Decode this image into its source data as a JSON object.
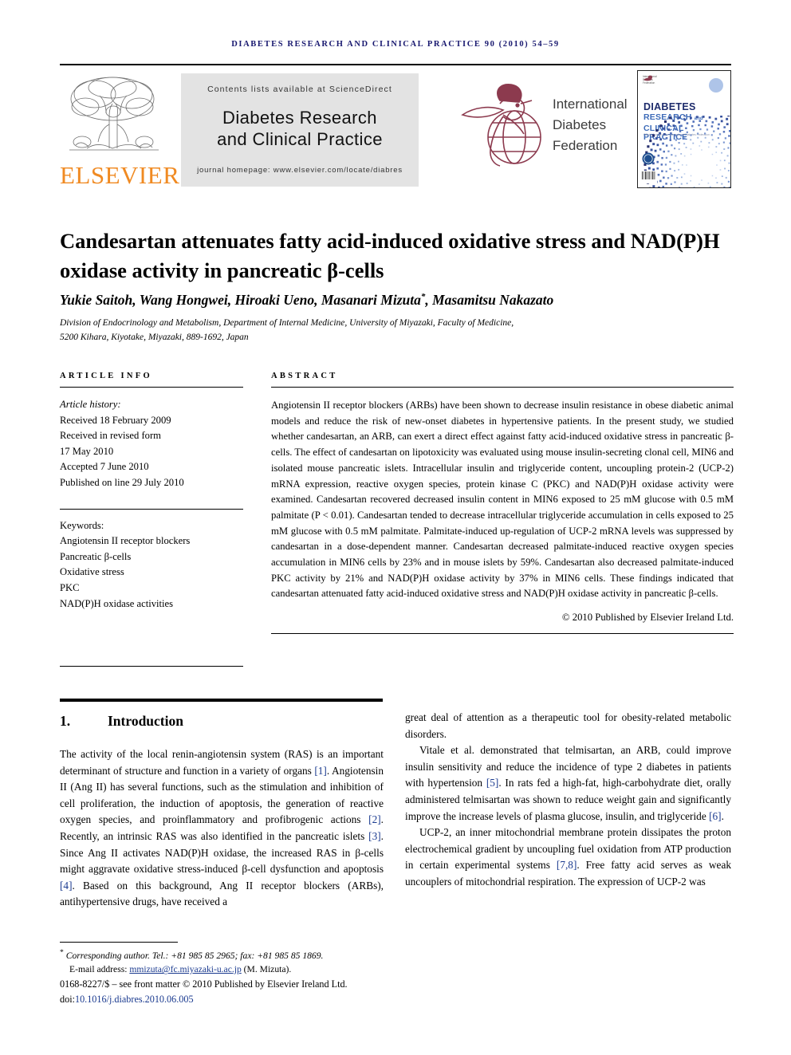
{
  "running_head": "Diabetes Research and Clinical Practice 90 (2010) 54–59",
  "masthead": {
    "publisher_name": "ELSEVIER",
    "sciencedirect_line": "Contents lists available at ScienceDirect",
    "journal_title_line1": "Diabetes Research",
    "journal_title_line2": "and Clinical Practice",
    "homepage_line": "journal homepage: www.elsevier.com/locate/diabres",
    "idf_line1": "International",
    "idf_line2": "Diabetes",
    "idf_line3": "Federation",
    "cover": {
      "idf_mini": "International\nDiabetes\nFederation",
      "title_top": "DIABETES",
      "title_rest": "RESEARCH and\nCLINICAL PRACTICE",
      "subtitle": "Official Journal of the International Diabetes Federation"
    }
  },
  "article": {
    "title": "Candesartan attenuates fatty acid-induced oxidative stress and NAD(P)H oxidase activity in pancreatic β-cells",
    "authors": "Yukie Saitoh, Wang Hongwei, Hiroaki Ueno, Masanari Mizuta",
    "author_marker": "*",
    "authors_tail": ", Masamitsu Nakazato",
    "affiliation_line1": "Division of Endocrinology and Metabolism, Department of Internal Medicine, University of Miyazaki, Faculty of Medicine,",
    "affiliation_line2": "5200 Kihara, Kiyotake, Miyazaki, 889-1692, Japan"
  },
  "info": {
    "heading": "Article info",
    "history_label": "Article history:",
    "received": "Received 18 February 2009",
    "revised_label": "Received in revised form",
    "revised_date": "17 May 2010",
    "accepted": "Accepted 7 June 2010",
    "published": "Published on line 29 July 2010",
    "keywords_label": "Keywords:",
    "keywords": [
      "Angiotensin II receptor blockers",
      "Pancreatic β-cells",
      "Oxidative stress",
      "PKC",
      "NAD(P)H oxidase activities"
    ]
  },
  "abstract": {
    "heading": "Abstract",
    "text": "Angiotensin II receptor blockers (ARBs) have been shown to decrease insulin resistance in obese diabetic animal models and reduce the risk of new-onset diabetes in hypertensive patients. In the present study, we studied whether candesartan, an ARB, can exert a direct effect against fatty acid-induced oxidative stress in pancreatic β-cells. The effect of candesartan on lipotoxicity was evaluated using mouse insulin-secreting clonal cell, MIN6 and isolated mouse pancreatic islets. Intracellular insulin and triglyceride content, uncoupling protein-2 (UCP-2) mRNA expression, reactive oxygen species, protein kinase C (PKC) and NAD(P)H oxidase activity were examined. Candesartan recovered decreased insulin content in MIN6 exposed to 25 mM glucose with 0.5 mM palmitate (P < 0.01). Candesartan tended to decrease intracellular triglyceride accumulation in cells exposed to 25 mM glucose with 0.5 mM palmitate. Palmitate-induced up-regulation of UCP-2 mRNA levels was suppressed by candesartan in a dose-dependent manner. Candesartan decreased palmitate-induced reactive oxygen species accumulation in MIN6 cells by 23% and in mouse islets by 59%. Candesartan also decreased palmitate-induced PKC activity by 21% and NAD(P)H oxidase activity by 37% in MIN6 cells. These findings indicated that candesartan attenuated fatty acid-induced oxidative stress and NAD(P)H oxidase activity in pancreatic β-cells.",
    "copyright": "© 2010 Published by Elsevier Ireland Ltd."
  },
  "section": {
    "number": "1.",
    "heading": "Introduction"
  },
  "body": {
    "left_p1_a": "The activity of the local renin-angiotensin system (RAS) is an important determinant of structure and function in a variety of organs ",
    "ref1": "[1]",
    "left_p1_b": ". Angiotensin II (Ang II) has several functions, such as the stimulation and inhibition of cell proliferation, the induction of apoptosis, the generation of reactive oxygen species, and proinflammatory and profibrogenic actions ",
    "ref2": "[2]",
    "left_p1_c": ". Recently, an intrinsic RAS was also identified in the pancreatic islets ",
    "ref3": "[3]",
    "left_p1_d": ". Since Ang II activates NAD(P)H oxidase, the increased RAS in β-cells might aggravate oxidative stress-induced β-cell dysfunction and apoptosis ",
    "ref4": "[4]",
    "left_p1_e": ". Based on this background, Ang II receptor blockers (ARBs), antihypertensive drugs, have received a",
    "right_p1": "great deal of attention as a therapeutic tool for obesity-related metabolic disorders.",
    "right_p2_a": "Vitale et al. demonstrated that telmisartan, an ARB, could improve insulin sensitivity and reduce the incidence of type 2 diabetes in patients with hypertension ",
    "ref5": "[5]",
    "right_p2_b": ". In rats fed a high-fat, high-carbohydrate diet, orally administered telmisartan was shown to reduce weight gain and significantly improve the increase levels of plasma glucose, insulin, and triglyceride ",
    "ref6": "[6]",
    "right_p2_c": ".",
    "right_p3_a": "UCP-2, an inner mitochondrial membrane protein dissipates the proton electrochemical gradient by uncoupling fuel oxidation from ATP production in certain experimental systems ",
    "ref78": "[7,8]",
    "right_p3_b": ". Free fatty acid serves as weak uncouplers of mitochondrial respiration. The expression of UCP-2 was"
  },
  "footnote": {
    "marker": "*",
    "corresponding": "Corresponding author. Tel.: +81 985 85 2965; fax: +81 985 85 1869.",
    "email_label": "E-mail address:",
    "email": "mmizuta@fc.miyazaki-u.ac.jp",
    "email_owner": "(M. Mizuta).",
    "issn_line": "0168-8227/$ – see front matter © 2010 Published by Elsevier Ireland Ltd.",
    "doi_label": "doi:",
    "doi": "10.1016/j.diabres.2010.06.005"
  },
  "colors": {
    "running_head": "#191970",
    "elsevier_orange": "#F08A22",
    "link_blue": "#1a3a8f",
    "idf_maroon": "#8c3a4e",
    "cover_navy": "#1d2b6b",
    "cover_blue": "#3d6bb8",
    "banner_gray": "#e3e3e3"
  }
}
